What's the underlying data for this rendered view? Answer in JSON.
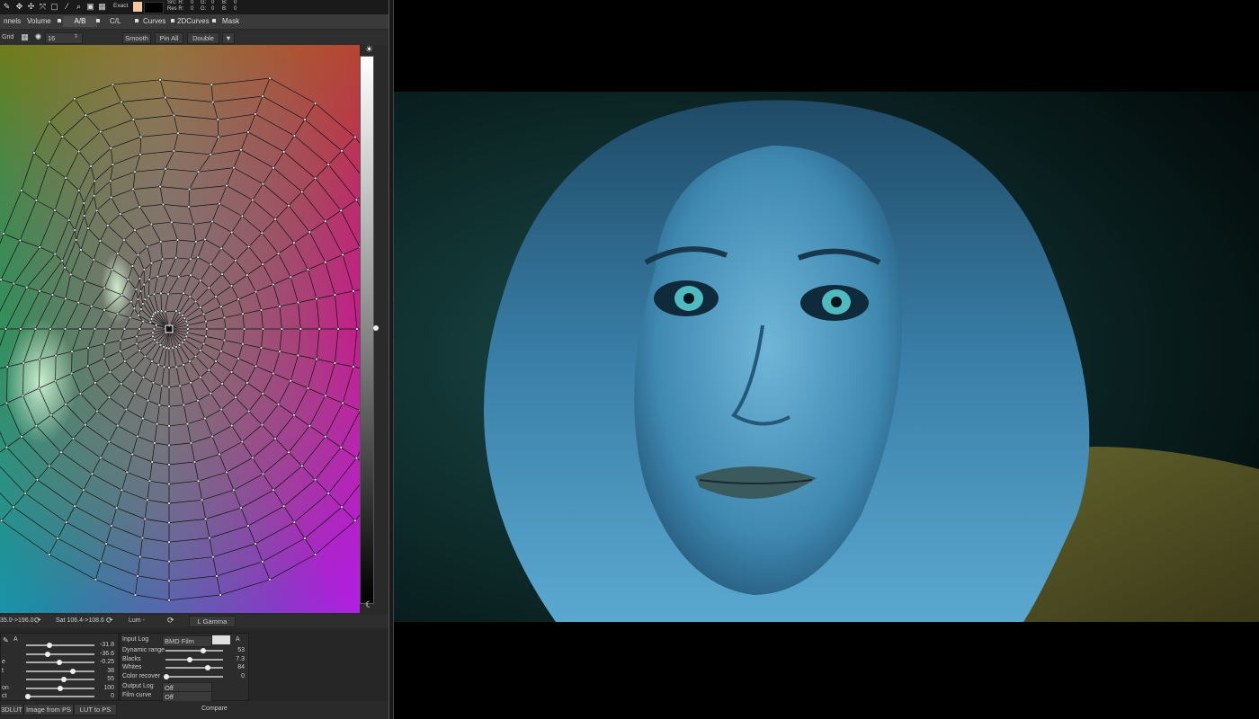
{
  "toolbar": {
    "exact_label": "Exact",
    "src_label": "Src: R:",
    "src_r": "0",
    "src_g_label": "G:",
    "src_g": "0",
    "src_b_label": "B:",
    "src_b": "0",
    "res_label": "Res R:",
    "res_r": "0",
    "res_g_label": "G:",
    "res_g": "0",
    "res_b_label": "B:",
    "res_b": "0",
    "icons": [
      "pipette-icon",
      "move-icon",
      "pan-icon",
      "scale-icon",
      "select-icon",
      "picker-icon",
      "zoom-icon",
      "frame-icon",
      "grid-icon"
    ],
    "swatch_color": "#f2c9a0"
  },
  "tabs": [
    {
      "label": "nnels"
    },
    {
      "label": "Volume"
    },
    {
      "label": "A/B"
    },
    {
      "label": "C/L"
    },
    {
      "label": "Curves"
    },
    {
      "label": "2DCurves"
    },
    {
      "label": "Mask"
    }
  ],
  "controls": {
    "grid_label": "Grid",
    "grid_value": "16",
    "smooth_label": "Smooth",
    "pin_all_label": "Pin All",
    "double_label": "Double"
  },
  "wheel_bottom": {
    "hue_readout": "35.0->196.0",
    "sat_readout": "Sat 106.4->108.6",
    "lum_label": "Lum -",
    "gamma_label": "L Gamma"
  },
  "left_sliders": [
    {
      "label": "",
      "value": "-31.8",
      "level": 0.34
    },
    {
      "label": "",
      "value": "-36.6",
      "level": 0.32
    },
    {
      "label": "e",
      "value": "-0.25",
      "level": 0.49
    },
    {
      "label": "t",
      "value": "38",
      "level": 0.68
    },
    {
      "label": "",
      "value": "55",
      "level": 0.55
    },
    {
      "label": "on",
      "value": "100",
      "level": 0.5
    },
    {
      "label": "ct",
      "value": "0",
      "level": 0.02
    }
  ],
  "right_panel": {
    "input_log_label": "Input Log",
    "input_log_value": "BMD Film",
    "a_label": "A",
    "rows": [
      {
        "label": "Dynamic range",
        "value": "53",
        "level": 0.65
      },
      {
        "label": "Blacks",
        "value": "7.3",
        "level": 0.42
      },
      {
        "label": "Whites",
        "value": "84",
        "level": 0.73
      },
      {
        "label": "Color recover",
        "value": "0",
        "level": 0.02
      }
    ],
    "output_log_label": "Output Log",
    "output_log_value": "Off",
    "film_curve_label": "Film curve",
    "film_curve_value": "Off"
  },
  "footer": {
    "load_3dlut": "3DLUT",
    "image_from_ps": "Image from PS",
    "lut_to_ps": "LUT to PS",
    "compare": "Compare"
  }
}
